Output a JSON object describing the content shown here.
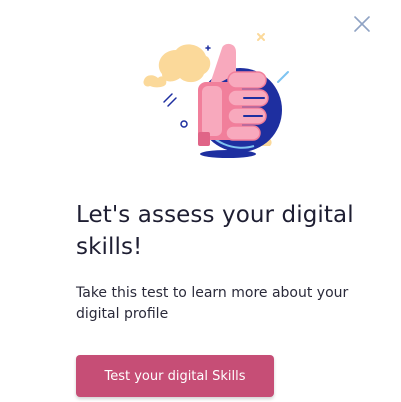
{
  "dialog": {
    "title": "Let's assess your digital skills!",
    "description": "Take this test to learn more about your digital profile",
    "cta_label": "Test your digital Skills",
    "close_icon": "close-icon",
    "illustration_icon": "thumbs-up-icon"
  },
  "colors": {
    "accent": "#c64e76",
    "title_text": "#1e1e32",
    "close_icon": "#8fa3c4",
    "illustration_blue": "#1e2fa0",
    "illustration_pink": "#f17f9b",
    "illustration_cream": "#fbd99a"
  }
}
